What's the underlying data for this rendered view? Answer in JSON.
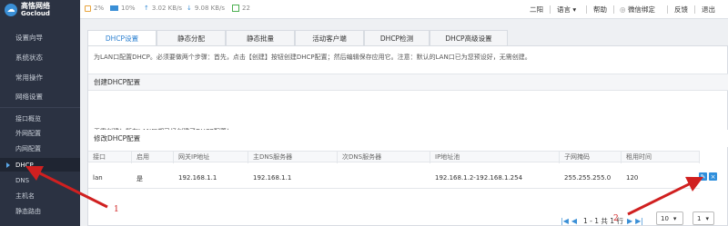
{
  "brand": {
    "line1": "高恪网络",
    "line2": "Gocloud"
  },
  "sidebar": {
    "top_items": [
      "设置向导",
      "系统状态",
      "常用操作",
      "网络设置"
    ],
    "sub_items": [
      "接口概览",
      "外网配置",
      "内网配置",
      "DHCP",
      "DNS",
      "主机名",
      "静态路由"
    ],
    "active": "DHCP"
  },
  "topbar": {
    "cpu": "2%",
    "mem": "10%",
    "up": "3.02 KB/s",
    "down": "9.08 KB/s",
    "users": "22",
    "user": "二阳",
    "lang": "语言",
    "help": "帮助",
    "wechat": "微信绑定",
    "feedback": "反馈",
    "logout": "退出"
  },
  "tabs": [
    "DHCP设置",
    "静态分配",
    "静态批量",
    "活动客户端",
    "DHCP检测",
    "DHCP高级设置"
  ],
  "info": "为LAN口配置DHCP。必须要做两个步骤：首先，点击【创建】按钮创建DHCP配置；然后编辑保存应用它。注意：默认的LAN口已为您预设好，无需创建。",
  "create_section": {
    "title": "创建DHCP配置",
    "message": "无需创建！所有LAN口都已经创建了DHCP配置！"
  },
  "modify_section": {
    "title": "修改DHCP配置"
  },
  "table": {
    "headers": [
      "接口",
      "启用",
      "网关IP地址",
      "主DNS服务器",
      "次DNS服务器",
      "IP地址池",
      "子网掩码",
      "租用时间"
    ],
    "rows": [
      [
        "lan",
        "是",
        "192.168.1.1",
        "192.168.1.1",
        "",
        "192.168.1.2-192.168.1.254",
        "255.255.255.0",
        "120"
      ]
    ]
  },
  "pager": {
    "text": "1 - 1 共 1 行",
    "page_size": "10",
    "page": "1"
  },
  "annotations": {
    "a1": "1",
    "a2": "2"
  },
  "colors": {
    "accent": "#2a7fd0",
    "sidebar_bg": "#2b3242",
    "annotation": "#d02020"
  }
}
